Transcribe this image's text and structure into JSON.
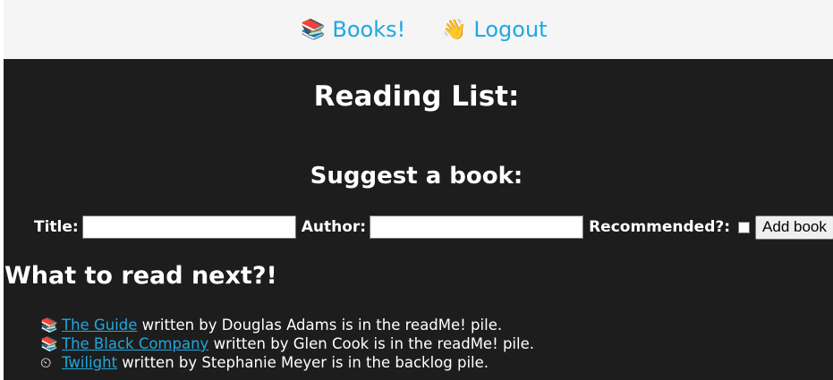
{
  "nav": {
    "books": {
      "icon": "📚",
      "label": "Books!"
    },
    "logout": {
      "icon": "👋",
      "label": "Logout"
    }
  },
  "main": {
    "title": "Reading List:",
    "suggest_title": "Suggest a book:",
    "form": {
      "title_label": "Title:",
      "title_value": "",
      "author_label": "Author:",
      "author_value": "",
      "recommended_label": "Recommended?:",
      "recommended_checked": false,
      "add_button": "Add book"
    },
    "next_title": "What to read next?!",
    "books": [
      {
        "icon": "📚",
        "title": "The Guide",
        "written_by": "written by",
        "author": "Douglas Adams",
        "in_pile": "is in the",
        "pile": "readMe!",
        "pile_word": "pile."
      },
      {
        "icon": "📚",
        "title": "The Black Company",
        "written_by": "written by",
        "author": "Glen Cook",
        "in_pile": "is in the",
        "pile": "readMe!",
        "pile_word": "pile."
      },
      {
        "icon": "⏲",
        "title": "Twilight",
        "written_by": "written by",
        "author": "Stephanie Meyer",
        "in_pile": "is in the",
        "pile": "backlog",
        "pile_word": "pile."
      }
    ]
  }
}
